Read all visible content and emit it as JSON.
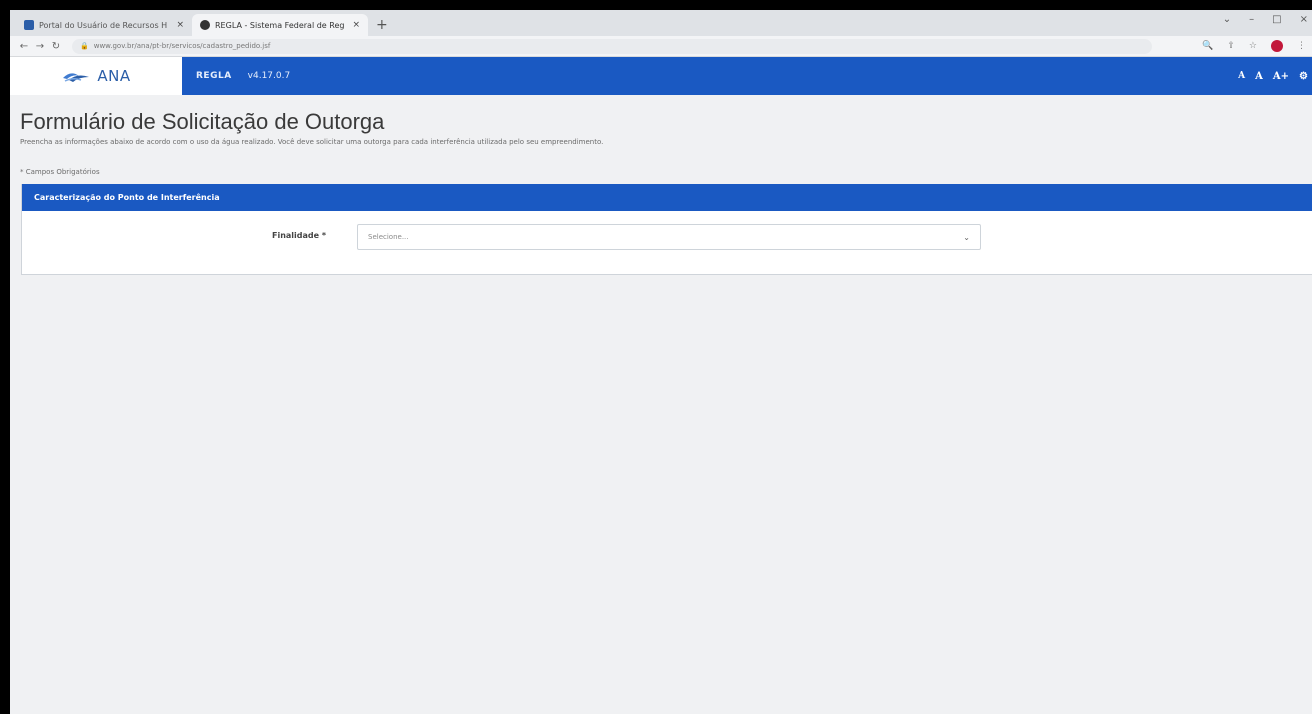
{
  "browser": {
    "tabs": [
      {
        "title": "Portal do Usuário de Recursos H",
        "close": "×",
        "favicon_color": "#2b5ea8"
      },
      {
        "title": "REGLA - Sistema Federal de Reg",
        "close": "×",
        "favicon_color": "#333333"
      }
    ],
    "new_tab": "+",
    "window_controls": {
      "dropdown": "⌄",
      "minimize": "–",
      "restore": "□",
      "close": "×"
    },
    "nav": {
      "back": "←",
      "forward": "→",
      "reload": "↻"
    },
    "url": "www.gov.br/ana/pt-br/servicos/cadastro_pedido.jsf",
    "toolbar_icons": {
      "zoom": "🔍",
      "share": "⇪",
      "bookmark": "☆",
      "menu": "⋮"
    }
  },
  "header": {
    "brand": "ANA",
    "system": "REGLA",
    "version": "v4.17.0.7",
    "font_controls": [
      "A",
      "A",
      "A+"
    ],
    "settings_icon": "gear-icon"
  },
  "page": {
    "title": "Formulário de Solicitação de Outorga",
    "subtitle": "Preencha as informações abaixo de acordo com o uso da água realizado. Você deve solicitar uma outorga para cada interferência utilizada pelo seu empreendimento.",
    "required_note": "* Campos Obrigatórios"
  },
  "panel": {
    "title": "Caracterização do Ponto de Interferência",
    "field_label": "Finalidade *",
    "select_placeholder": "Selecione..."
  },
  "colors": {
    "primary": "#1a59c2",
    "background": "#f0f1f3"
  }
}
